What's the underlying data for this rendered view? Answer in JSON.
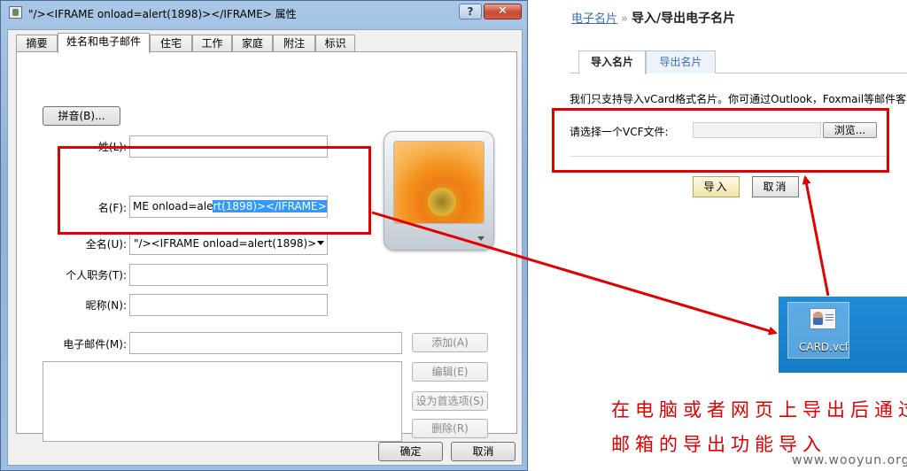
{
  "dialog": {
    "title": "\"/><IFRAME onload=alert(1898)></IFRAME> 属性",
    "help_label": "?",
    "close_label": "✕",
    "tabs": [
      {
        "label": "摘要",
        "active": false
      },
      {
        "label": "姓名和电子邮件",
        "active": true
      },
      {
        "label": "住宅",
        "active": false
      },
      {
        "label": "工作",
        "active": false
      },
      {
        "label": "家庭",
        "active": false
      },
      {
        "label": "附注",
        "active": false
      },
      {
        "label": "标识",
        "active": false
      }
    ],
    "pinyin_button": "拼音(B)...",
    "fields": {
      "surname_label": "姓(L):",
      "surname_value": "",
      "given_label": "名(F):",
      "given_value_plain": "ME  onload=ale",
      "given_value_selected": "rt(1898)></IFRAME>",
      "fullname_label": "全名(U):",
      "fullname_value": "\"/><IFRAME onload=alert(1898)>",
      "title_label": "个人职务(T):",
      "title_value": "",
      "nickname_label": "昵称(N):",
      "nickname_value": "",
      "email_label": "电子邮件(M):",
      "email_value": ""
    },
    "side_buttons": {
      "add": "添加(A)",
      "edit": "编辑(E)",
      "default": "设为首选项(S)",
      "delete": "删除(R)"
    },
    "ok_button": "确定",
    "cancel_button": "取消"
  },
  "web": {
    "breadcrumb_link": "电子名片",
    "breadcrumb_sep": "»",
    "breadcrumb_current": "导入/导出电子名片",
    "tabs": [
      {
        "label": "导入名片",
        "active": true
      },
      {
        "label": "导出名片",
        "active": false
      }
    ],
    "description": "我们只支持导入vCard格式名片。你可通过Outlook，Foxmail等邮件客",
    "file_label": "请选择一个VCF文件:",
    "browse_button": "浏览...",
    "import_button": "导入",
    "cancel_button": "取消"
  },
  "desktop": {
    "file_name": "CARD.vcf"
  },
  "annotation": {
    "line1": "在电脑或者网页上导出后通过",
    "line2": "邮箱的导出功能导入",
    "color": "#e00000"
  },
  "watermark": "www.wooyun.org"
}
